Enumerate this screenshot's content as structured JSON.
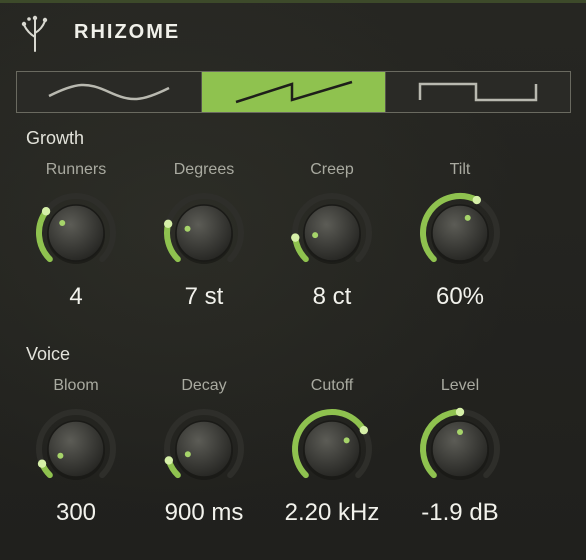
{
  "header": {
    "title": "RHIZOME",
    "logo_icon": "sprout-icon"
  },
  "waveforms": [
    {
      "name": "sine",
      "icon": "sine-wave-icon",
      "active": false
    },
    {
      "name": "saw",
      "icon": "saw-wave-icon",
      "active": true
    },
    {
      "name": "square",
      "icon": "square-wave-icon",
      "active": false
    }
  ],
  "colors": {
    "accent": "#8fc24f",
    "background": "#232320",
    "knob": "#3a3a36"
  },
  "sections": [
    {
      "label": "Growth",
      "knobs": [
        {
          "label": "Runners",
          "value": "4",
          "level": 0.3
        },
        {
          "label": "Degrees",
          "value": "7 st",
          "level": 0.22
        },
        {
          "label": "Creep",
          "value": "8 ct",
          "level": 0.14
        },
        {
          "label": "Tilt",
          "value": "60%",
          "level": 0.6
        }
      ]
    },
    {
      "label": "Voice",
      "knobs": [
        {
          "label": "Bloom",
          "value": "300",
          "level": 0.08
        },
        {
          "label": "Decay",
          "value": "900 ms",
          "level": 0.1
        },
        {
          "label": "Cutoff",
          "value": "2.20 kHz",
          "level": 0.72
        },
        {
          "label": "Level",
          "value": "-1.9 dB",
          "level": 0.5
        }
      ]
    }
  ]
}
